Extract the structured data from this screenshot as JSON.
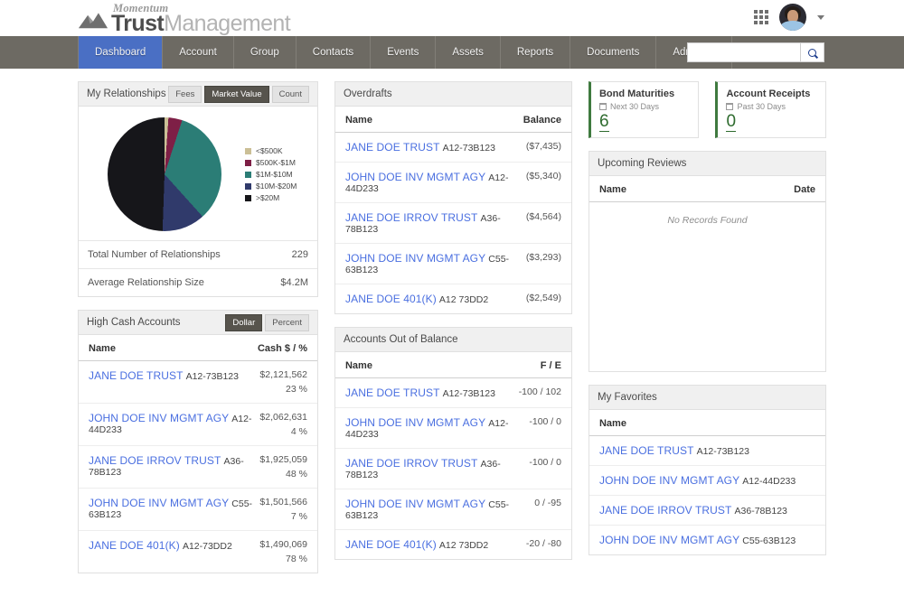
{
  "brand": {
    "script": "Momentum",
    "bold": "Trust",
    "light": "Management"
  },
  "header": {
    "apps_icon": "grid-apps-icon",
    "avatar_alt": "user-avatar",
    "profile_caret": "chevron-down-icon"
  },
  "nav": {
    "items": [
      {
        "label": "Dashboard",
        "active": true
      },
      {
        "label": "Account",
        "active": false
      },
      {
        "label": "Group",
        "active": false
      },
      {
        "label": "Contacts",
        "active": false
      },
      {
        "label": "Events",
        "active": false
      },
      {
        "label": "Assets",
        "active": false
      },
      {
        "label": "Reports",
        "active": false
      },
      {
        "label": "Documents",
        "active": false
      },
      {
        "label": "Admin",
        "active": false,
        "caret": true
      }
    ],
    "search": {
      "value": "",
      "placeholder": "",
      "icon": "search-icon"
    }
  },
  "relationships": {
    "title": "My Relationships",
    "toggles": [
      {
        "label": "Fees",
        "active": false
      },
      {
        "label": "Market Value",
        "active": true
      },
      {
        "label": "Count",
        "active": false
      }
    ],
    "stats": [
      {
        "label": "Total Number of Relationships",
        "value": "229"
      },
      {
        "label": "Average Relationship Size",
        "value": "$4.2M"
      }
    ]
  },
  "chart_data": {
    "type": "pie",
    "title": "My Relationships",
    "metric": "Market Value",
    "legend_position": "right",
    "categories": [
      "<$500K",
      "$500K-$1M",
      "$1M-$10M",
      "$10M-$20M",
      ">$20M"
    ],
    "values": [
      1,
      4,
      33,
      12,
      50
    ],
    "unit": "percent",
    "colors": [
      "#cbbf96",
      "#7e1f46",
      "#2b7d76",
      "#303a6b",
      "#16161a"
    ]
  },
  "high_cash": {
    "title": "High Cash Accounts",
    "toggles": [
      {
        "label": "Dollar",
        "active": true
      },
      {
        "label": "Percent",
        "active": false
      }
    ],
    "columns": [
      "Name",
      "Cash $ / %"
    ],
    "rows": [
      {
        "name": "JANE DOE TRUST",
        "number": "A12-73B123",
        "amount": "$2,121,562",
        "pct": "23 %"
      },
      {
        "name": "JOHN DOE INV MGMT AGY",
        "number": "A12-44D233",
        "amount": "$2,062,631",
        "pct": "4 %"
      },
      {
        "name": "JANE DOE IRROV TRUST",
        "number": "A36-78B123",
        "amount": "$1,925,059",
        "pct": "48 %"
      },
      {
        "name": "JOHN DOE INV MGMT AGY",
        "number": "C55-63B123",
        "amount": "$1,501,566",
        "pct": "7 %"
      },
      {
        "name": "JANE DOE 401(K)",
        "number": "A12-73DD2",
        "amount": "$1,490,069",
        "pct": "78 %"
      }
    ]
  },
  "overdrafts": {
    "title": "Overdrafts",
    "columns": [
      "Name",
      "Balance"
    ],
    "rows": [
      {
        "name": "JANE DOE TRUST",
        "number": "A12-73B123",
        "balance": "($7,435)"
      },
      {
        "name": "JOHN DOE INV MGMT AGY",
        "number": "A12-44D233",
        "balance": "($5,340)"
      },
      {
        "name": "JANE DOE IRROV TRUST",
        "number": "A36-78B123",
        "balance": "($4,564)"
      },
      {
        "name": "JOHN DOE INV MGMT AGY",
        "number": "C55-63B123",
        "balance": "($3,293)"
      },
      {
        "name": "JANE DOE 401(K)",
        "number": "A12 73DD2",
        "balance": "($2,549)"
      }
    ]
  },
  "out_of_balance": {
    "title": "Accounts Out of Balance",
    "columns": [
      "Name",
      "F / E"
    ],
    "rows": [
      {
        "name": "JANE DOE TRUST",
        "number": "A12-73B123",
        "fe": "-100 / 102"
      },
      {
        "name": "JOHN DOE INV MGMT AGY",
        "number": "A12-44D233",
        "fe": "-100 / 0"
      },
      {
        "name": "JANE DOE IRROV TRUST",
        "number": "A36-78B123",
        "fe": "-100 / 0"
      },
      {
        "name": "JOHN DOE INV MGMT AGY",
        "number": "C55-63B123",
        "fe": "0 / -95"
      },
      {
        "name": "JANE DOE 401(K)",
        "number": "A12 73DD2",
        "fe": "-20 / -80"
      }
    ]
  },
  "kpis": [
    {
      "title": "Bond Maturities",
      "sub": "Next 30 Days",
      "value": "6",
      "icon": "calendar-icon",
      "color": "#2e6b2e"
    },
    {
      "title": "Account Receipts",
      "sub": "Past 30 Days",
      "value": "0",
      "icon": "calendar-icon",
      "color": "#2e6b2e"
    }
  ],
  "upcoming_reviews": {
    "title": "Upcoming Reviews",
    "columns": [
      "Name",
      "Date"
    ],
    "empty": "No Records Found"
  },
  "favorites": {
    "title": "My Favorites",
    "columns": [
      "Name"
    ],
    "rows": [
      {
        "name": "JANE DOE TRUST",
        "number": "A12-73B123"
      },
      {
        "name": "JOHN DOE INV MGMT AGY",
        "number": "A12-44D233"
      },
      {
        "name": "JANE DOE IRROV TRUST",
        "number": "A36-78B123"
      },
      {
        "name": "JOHN DOE INV MGMT AGY",
        "number": "C55-63B123"
      }
    ]
  }
}
